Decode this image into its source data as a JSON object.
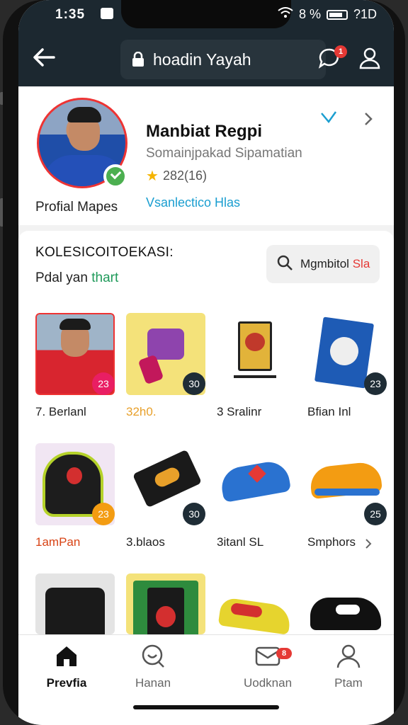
{
  "status_bar": {
    "time": "1:35",
    "right_text": "8 %",
    "signal_text": "?1D"
  },
  "header": {
    "title": "hoadin Yayah",
    "chat_badge": "1"
  },
  "profile": {
    "name": "Manbiat Regpi",
    "subtitle": "Somainjpakad Sipamatian",
    "rating": "282(16)",
    "link": "Vsanlectico Hlas",
    "label": "Profial Mapes"
  },
  "collection": {
    "title": "KOLESICOITOEKASI:",
    "subtitle_prefix": "Pdal yan",
    "subtitle_highlight": "thart",
    "filter_label": "Mgmbitol",
    "filter_label_red": "Sla",
    "items": [
      {
        "label": "7. Berlanl",
        "badge": "23",
        "icon": "player-photo"
      },
      {
        "label": "32h0.",
        "badge": "30",
        "icon": "jersey-set"
      },
      {
        "label": "3 Sralinr",
        "badge": "",
        "icon": "banner-stand"
      },
      {
        "label": "Bfian Inl",
        "badge": "23",
        "icon": "book-cover"
      },
      {
        "label": "1amPan",
        "badge": "23",
        "icon": "ball-bag"
      },
      {
        "label": "3.blaos",
        "badge": "30",
        "icon": "shin-guard"
      },
      {
        "label": "3itanl SL",
        "badge": "",
        "icon": "shoe-blue"
      },
      {
        "label": "Smphors",
        "badge": "25",
        "icon": "shoe-orange"
      },
      {
        "label": "",
        "badge": "",
        "icon": "bag-black"
      },
      {
        "label": "",
        "badge": "",
        "icon": "bag-green"
      },
      {
        "label": "",
        "badge": "",
        "icon": "boot-yellow"
      },
      {
        "label": "",
        "badge": "",
        "icon": "boot-black"
      }
    ]
  },
  "bottom_nav": [
    {
      "label": "Prevfia",
      "icon": "home-icon",
      "active": true
    },
    {
      "label": "Hanan",
      "icon": "search-chat-icon",
      "active": false
    },
    {
      "label": "Uodknan",
      "icon": "message-icon",
      "active": false,
      "badge": "8"
    },
    {
      "label": "Ptam",
      "icon": "person-icon",
      "active": false
    }
  ],
  "colors": {
    "header_bg": "#1c2830",
    "accent_link": "#1a9ed0",
    "badge_red": "#e53935",
    "verified_green": "#4caf50"
  }
}
